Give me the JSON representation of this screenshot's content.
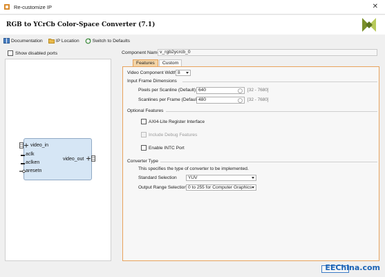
{
  "window": {
    "title": "Re-customize IP"
  },
  "header": {
    "heading": "RGB to YCrCb Color-Space Converter (7.1)"
  },
  "toolbar": {
    "documentation": "Documentation",
    "ip_location": "IP Location",
    "switch_defaults": "Switch to Defaults"
  },
  "left": {
    "show_disabled_ports": "Show disabled ports",
    "ports": {
      "video_in": "video_in",
      "aclk": "aclk",
      "aclken": "aclken",
      "aresetn": "aresetn",
      "video_out": "video_out"
    }
  },
  "component": {
    "label": "Component Name",
    "value": "v_rgb2ycrcb_0"
  },
  "tabs": [
    {
      "label": "Features"
    },
    {
      "label": "Custom"
    }
  ],
  "features": {
    "video_width_label": "Video Component Width",
    "video_width_value": "8",
    "input_frame_heading": "Input Frame Dimensions",
    "pixels_label": "Pixels per Scanline (Default)",
    "pixels_value": "640",
    "pixels_range": "[32 - 7680]",
    "scanlines_label": "Scanlines per Frame (Default)",
    "scanlines_value": "480",
    "scanlines_range": "[32 - 7680]",
    "optional_heading": "Optional Features",
    "axi_label": "AXI4-Lite Register Interface",
    "debug_label": "Include Debug Features",
    "intc_label": "Enable INTC Port",
    "converter_heading": "Converter Type",
    "converter_desc": "This specifies the type of converter to be implemented.",
    "standard_label": "Standard Selection",
    "standard_value": "YUV",
    "output_range_label": "Output Range Selection",
    "output_range_value": "0 to 255 for Computer Graphics"
  },
  "watermark": {
    "text": "EEChina.com"
  },
  "colors": {
    "accent": "#e8a25c",
    "block": "#d6e6f5",
    "watermark": "#1b63b5"
  }
}
